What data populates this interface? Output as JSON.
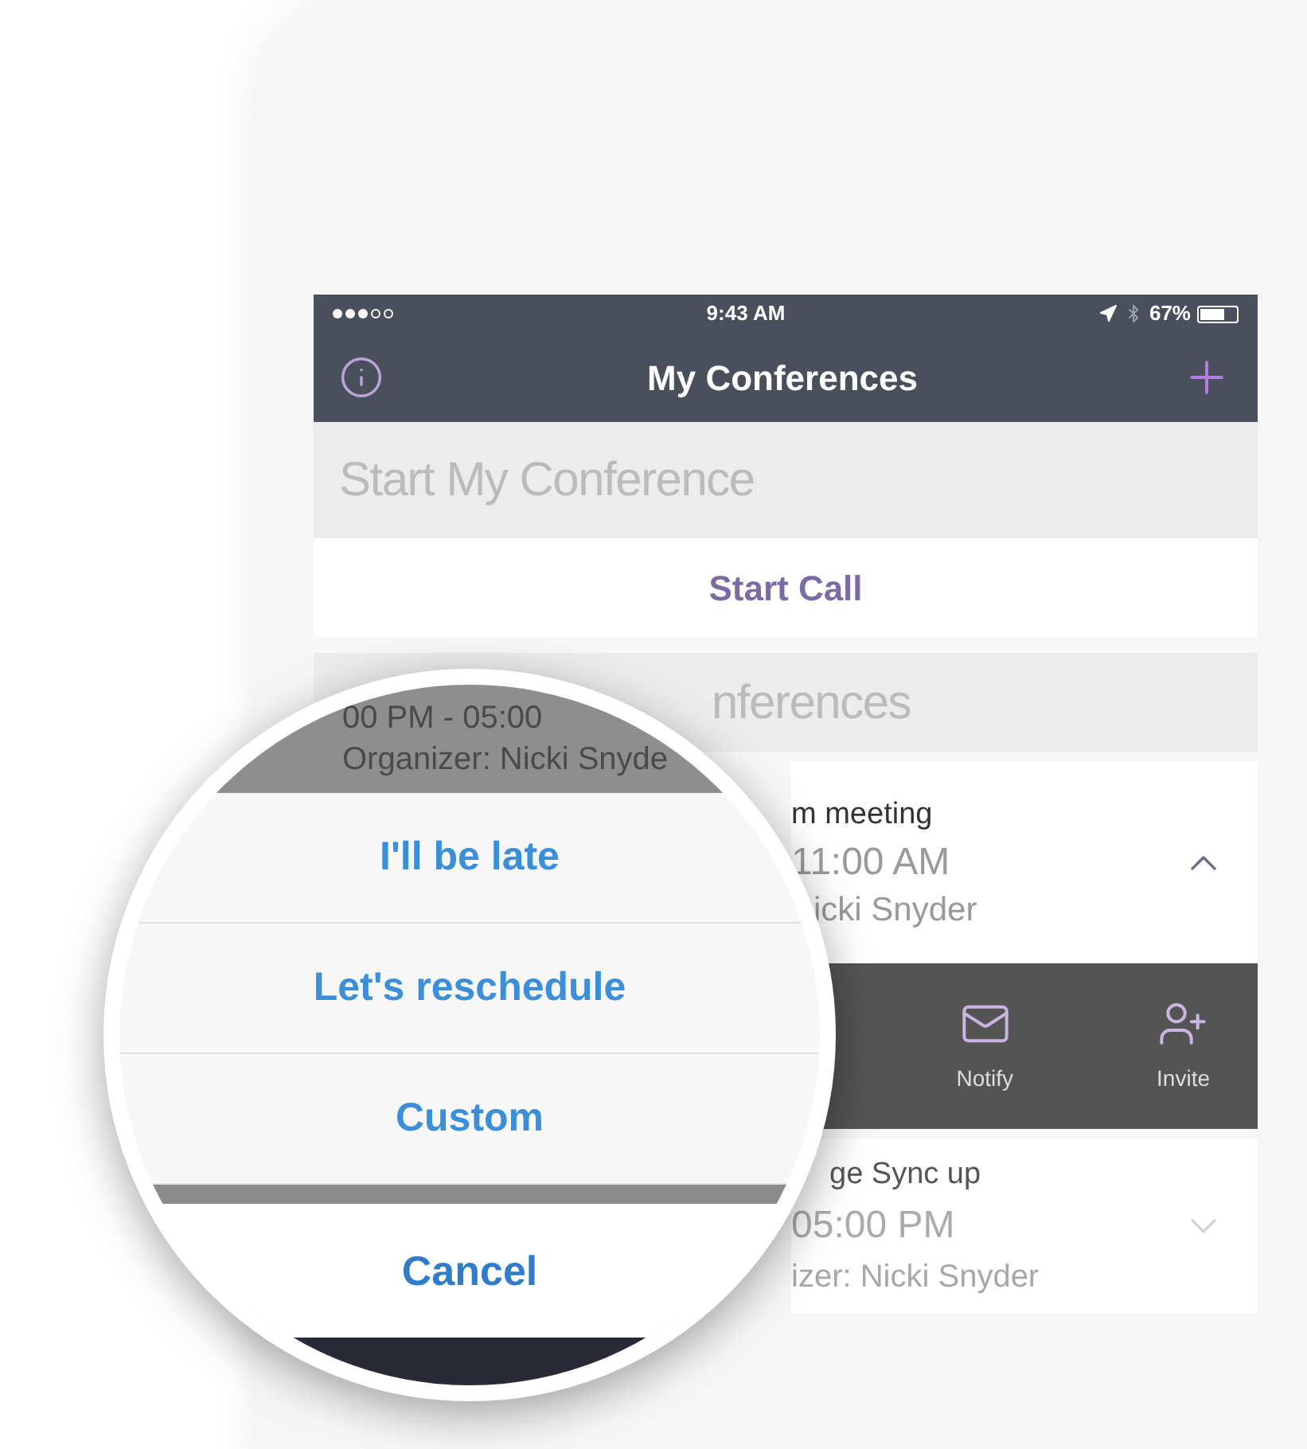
{
  "status_bar": {
    "time": "9:43 AM",
    "battery": "67%"
  },
  "nav": {
    "title": "My Conferences"
  },
  "start_section": {
    "header": "Start My Conference",
    "button": "Start Call"
  },
  "conferences_header": "nferences",
  "meeting": {
    "title": "m meeting",
    "time": "11:00 AM",
    "organizer": "icki Snyder",
    "expanded": true
  },
  "actions": [
    {
      "kind": "notify",
      "label": "Notify"
    },
    {
      "kind": "invite",
      "label": "Invite"
    }
  ],
  "meeting_2": {
    "title": "ge Sync up",
    "time": "05:00 PM",
    "organizer": "izer: Nicki Snyder",
    "expanded": false
  },
  "magnifier": {
    "behind": {
      "time": "00 PM - 05:00",
      "organizer": "Organizer: Nicki Snyde"
    },
    "options": [
      "I'll be late",
      "Let's reschedule",
      "Custom"
    ],
    "cancel": "Cancel"
  }
}
